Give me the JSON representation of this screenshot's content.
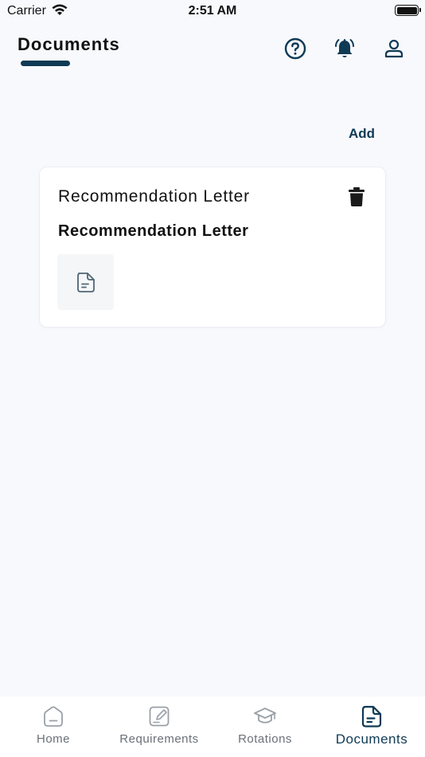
{
  "status_bar": {
    "carrier": "Carrier",
    "time": "2:51 AM"
  },
  "header": {
    "title": "Documents"
  },
  "actions": {
    "add_label": "Add"
  },
  "card": {
    "title": "Recommendation Letter",
    "subtitle": "Recommendation Letter"
  },
  "tabs": [
    {
      "label": "Home",
      "icon": "home-icon",
      "active": false
    },
    {
      "label": "Requirements",
      "icon": "edit-icon",
      "active": false
    },
    {
      "label": "Rotations",
      "icon": "graduation-cap-icon",
      "active": false
    },
    {
      "label": "Documents",
      "icon": "document-icon",
      "active": true
    }
  ],
  "colors": {
    "accent": "#0e3a55",
    "background": "#f8f9fc",
    "inactive_tab": "#6b7078"
  }
}
